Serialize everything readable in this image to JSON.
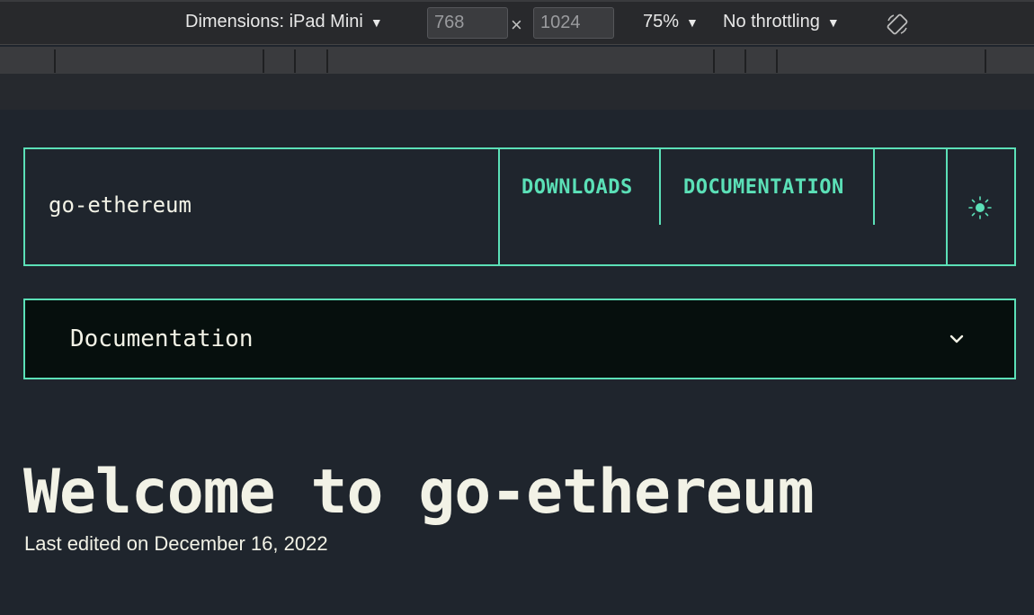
{
  "devtools": {
    "dimensions_label": "Dimensions: iPad Mini",
    "width_value": "768",
    "times_symbol": "×",
    "height_value": "1024",
    "zoom": "75%",
    "throttling": "No throttling",
    "caret": "▼",
    "rotate_icon": "rotate-device-icon"
  },
  "site": {
    "logo": "go-ethereum",
    "nav": {
      "downloads": "DOWNLOADS",
      "documentation": "DOCUMENTATION"
    },
    "theme_icon": "sun-icon",
    "doc_bar": {
      "label": "Documentation",
      "icon": "chevron-down-icon"
    },
    "title": "Welcome to go-ethereum",
    "last_edited": "Last edited on December 16, 2022"
  },
  "colors": {
    "accent": "#5be0b7",
    "page_bg": "#1f252d",
    "text": "#f2f2e6",
    "doc_bar_bg": "#060f0d"
  }
}
